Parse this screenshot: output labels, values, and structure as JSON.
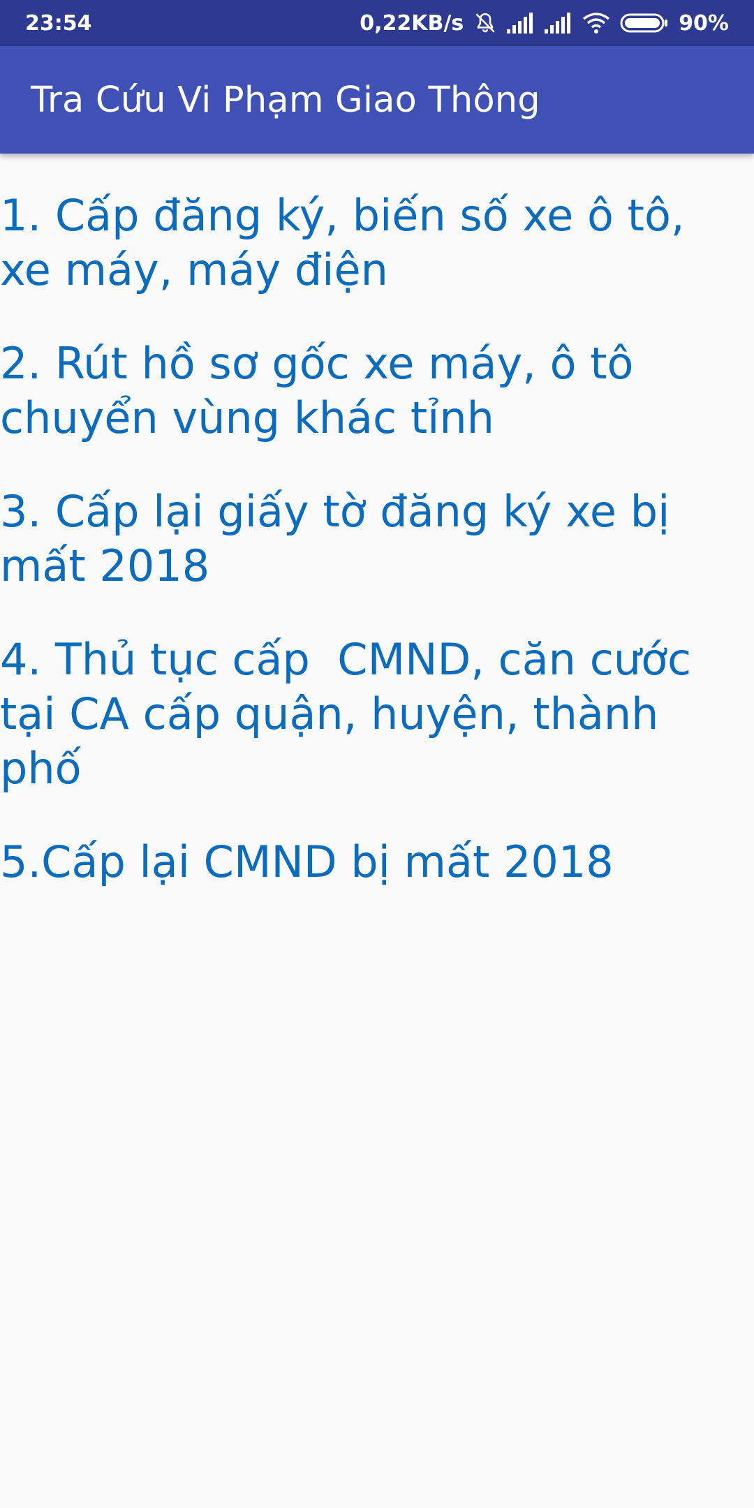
{
  "status_bar": {
    "time": "23:54",
    "network_speed": "0,22KB/s",
    "battery_percent": "90%",
    "icons": [
      "mute-bell-icon",
      "signal-icon",
      "signal-icon",
      "wifi-icon",
      "battery-icon"
    ],
    "background_color": "#2e3a92"
  },
  "app_bar": {
    "title": "Tra Cứu Vi Phạm Giao Thông",
    "background_color": "#3f51b5"
  },
  "list": {
    "link_color": "#0b6bbd",
    "items": [
      {
        "label": "1. Cấp đăng ký, biến số xe ô tô, xe máy, máy điện"
      },
      {
        "label": "2. Rút hồ sơ gốc xe máy, ô tô chuyển vùng khác tỉnh"
      },
      {
        "label": "3. Cấp lại giấy tờ đăng ký xe bị mất 2018"
      },
      {
        "label": "4. Thủ tục cấp  CMND, căn cước tại CA cấp quận, huyện, thành phố"
      },
      {
        "label": "5.Cấp lại CMND bị mất 2018"
      }
    ]
  }
}
